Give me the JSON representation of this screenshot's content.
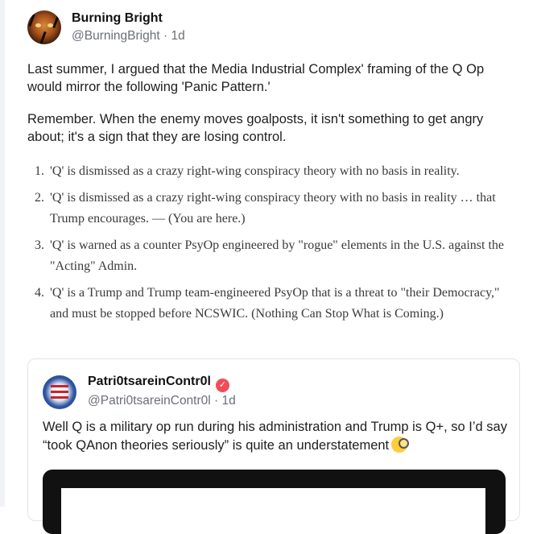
{
  "post": {
    "author": {
      "display_name": "Burning Bright",
      "handle": "@BurningBright",
      "separator": "·",
      "time": "1d"
    },
    "paragraphs": [
      "Last summer, I argued that the Media Industrial Complex' framing of the Q Op would mirror the following 'Panic Pattern.'",
      "Remember. When the enemy moves goalposts, it isn't something to get angry about; it's a sign that they are losing control."
    ],
    "list": [
      {
        "number": "1.",
        "text": "'Q' is dismissed as a crazy right-wing conspiracy theory with no basis in reality."
      },
      {
        "number": "2.",
        "text": "'Q' is dismissed as a crazy right-wing conspiracy theory with no basis in reality … that Trump encourages. — (You are here.)"
      },
      {
        "number": "3.",
        "text": "'Q' is warned as a counter PsyOp engineered by \"rogue\" elements in the U.S. against the \"Acting\" Admin."
      },
      {
        "number": "4.",
        "text": "'Q' is a Trump and Trump team-engineered PsyOp that is a threat to \"their Democracy,\" and must be stopped before NCSWIC. (Nothing Can Stop What is Coming.)"
      }
    ]
  },
  "quoted_post": {
    "author": {
      "display_name": "Patri0tsareinContr0l",
      "verified_icon": "verified-badge-icon",
      "handle": "@Patri0tsareinContr0l",
      "separator": "·",
      "time": "1d"
    },
    "text": "Well Q is a military op run during his administration and Trump is Q+, so I’d say “took QAnon theories seriously” is quite an understatement",
    "emoji": "monocle-face-icon"
  },
  "colors": {
    "verified": "#f04c5a",
    "muted_text": "#6b6f78"
  }
}
